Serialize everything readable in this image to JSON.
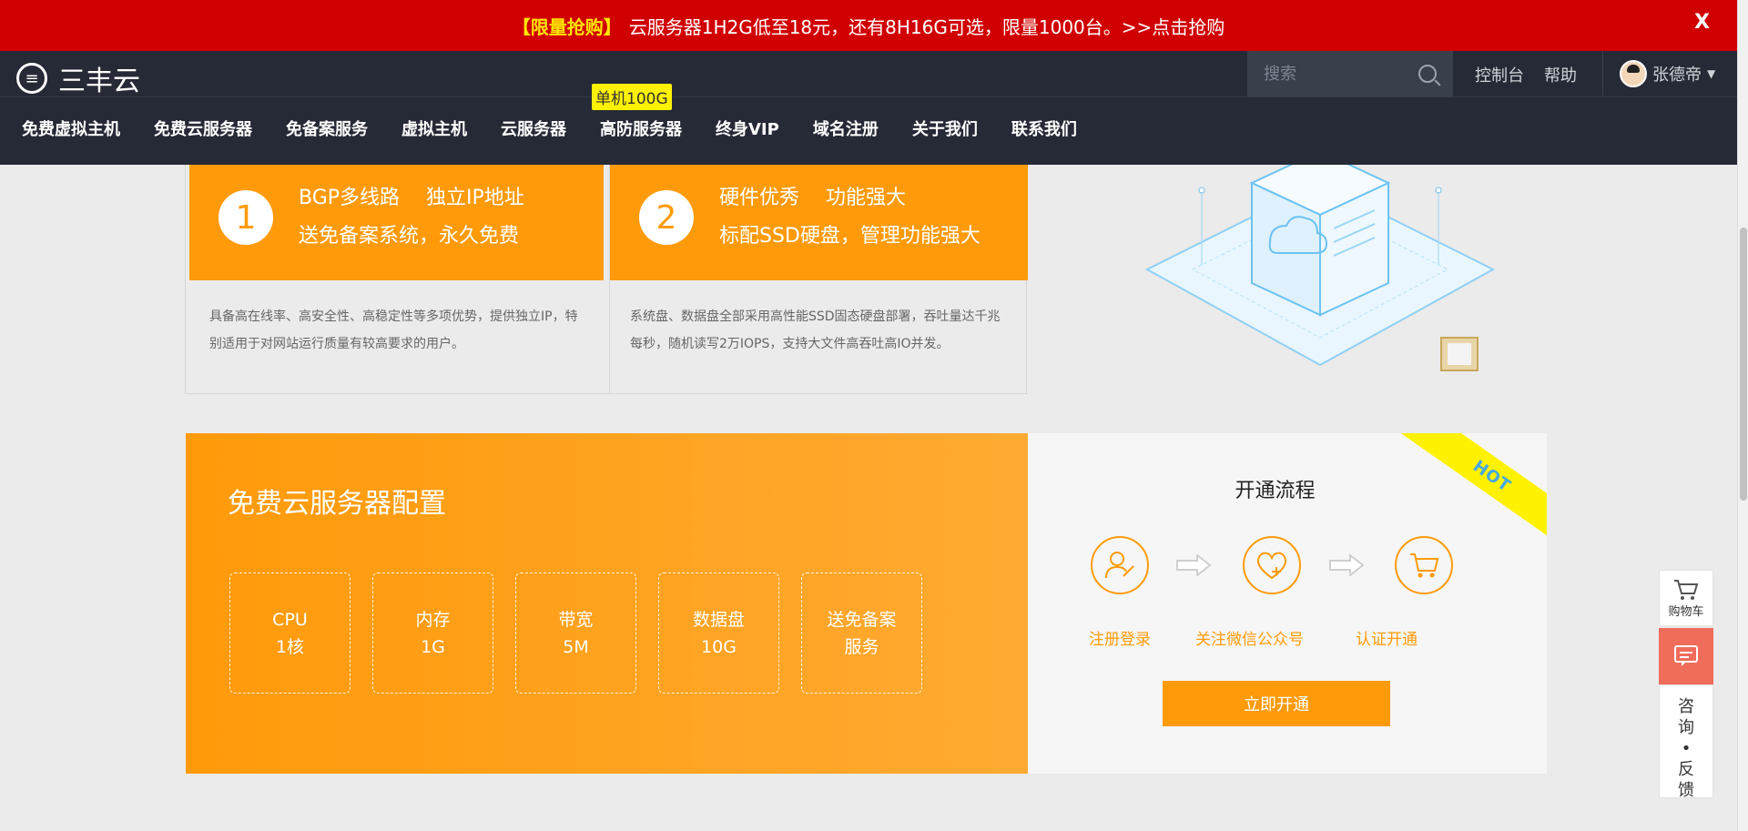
{
  "banner": {
    "highlight": "【限量抢购】",
    "text": "云服务器1H2G低至18元，还有8H16G可选，限量1000台。>>点击抢购",
    "close": "X"
  },
  "header": {
    "logo_text": "三丰云",
    "search_placeholder": "搜索",
    "links": [
      "控制台",
      "帮助"
    ],
    "user_name": "张德帝",
    "caret": "▼"
  },
  "nav": {
    "items": [
      "免费虚拟主机",
      "免费云服务器",
      "免备案服务",
      "虚拟主机",
      "云服务器",
      "高防服务器",
      "终身VIP",
      "域名注册",
      "关于我们",
      "联系我们"
    ],
    "badge": "单机100G"
  },
  "features": [
    {
      "num": "1",
      "line1": "BGP多线路　 独立IP地址",
      "line2": "送免备案系统，永久免费",
      "desc": "具备高在线率、高安全性、高稳定性等多项优势，提供独立IP，特别适用于对网站运行质量有较高要求的用户。"
    },
    {
      "num": "2",
      "line1": "硬件优秀　 功能强大",
      "line2": "标配SSD硬盘，管理功能强大",
      "desc": "系统盘、数据盘全部采用高性能SSD固态硬盘部署，吞吐量达千兆每秒，随机读写2万IOPS，支持大文件高吞吐高IO并发。"
    }
  ],
  "config": {
    "title": "免费云服务器配置",
    "boxes": [
      {
        "line1": "CPU",
        "line2": "1核"
      },
      {
        "line1": "内存",
        "line2": "1G"
      },
      {
        "line1": "带宽",
        "line2": "5M"
      },
      {
        "line1": "数据盘",
        "line2": "10G"
      },
      {
        "line1": "送免备案",
        "line2": "服务"
      }
    ]
  },
  "flow": {
    "hot": "HOT",
    "title": "开通流程",
    "steps": [
      "注册登录",
      "关注微信公众号",
      "认证开通"
    ],
    "button": "立即开通"
  },
  "side": {
    "cart": "购物车",
    "consult": "咨\n询\n•\n反\n馈"
  },
  "colors": {
    "banner_red": "#d10000",
    "header_dark": "#262a36",
    "orange": "#ff9b0b",
    "yellow": "#fff200"
  }
}
